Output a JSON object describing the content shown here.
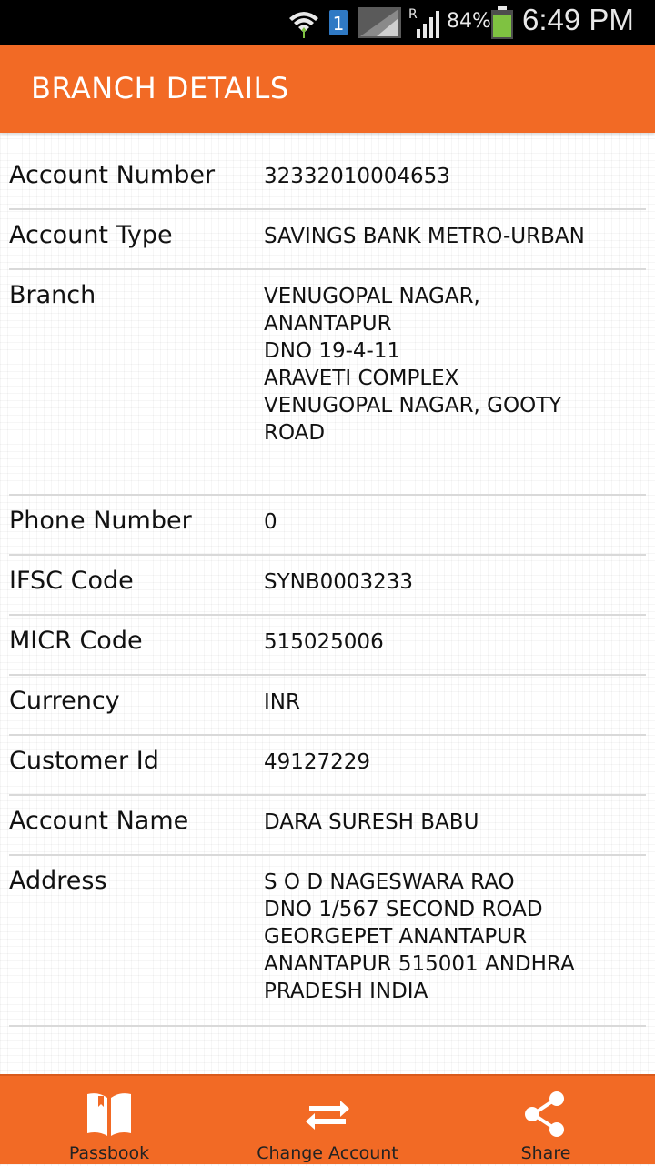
{
  "status_bar": {
    "sim_slot": "1",
    "roaming_indicator": "R",
    "battery_percent": "84%",
    "time": "6:49 PM",
    "icons": [
      "wifi-icon",
      "sim-icon",
      "signal-icon",
      "roaming-signal-icon",
      "battery-icon"
    ]
  },
  "header": {
    "title": "BRANCH DETAILS"
  },
  "details": [
    {
      "label": "Account Number",
      "value": "32332010004653"
    },
    {
      "label": "Account Type",
      "value": "SAVINGS BANK  METRO-URBAN"
    },
    {
      "label": "Branch",
      "value": "VENUGOPAL NAGAR,\nANANTAPUR\nDNO 19-4-11\nARAVETI COMPLEX\nVENUGOPAL NAGAR, GOOTY\nROAD"
    },
    {
      "label": "Phone Number",
      "value": "0"
    },
    {
      "label": "IFSC Code",
      "value": "SYNB0003233"
    },
    {
      "label": "MICR Code",
      "value": "515025006"
    },
    {
      "label": "Currency",
      "value": "INR"
    },
    {
      "label": "Customer Id",
      "value": "49127229"
    },
    {
      "label": "Account Name",
      "value": "DARA SURESH BABU"
    },
    {
      "label": "Address",
      "value": "S O D NAGESWARA RAO\nDNO 1/567 SECOND ROAD\nGEORGEPET  ANANTAPUR\nANANTAPUR 515001 ANDHRA\nPRADESH INDIA"
    }
  ],
  "bottom_nav": {
    "passbook": {
      "label": "Passbook",
      "icon": "book-icon"
    },
    "change_account": {
      "label": "Change Account",
      "icon": "swap-arrows-icon"
    },
    "share": {
      "label": "Share",
      "icon": "share-icon"
    }
  },
  "colors": {
    "accent": "#f26a25",
    "text": "#111111",
    "divider": "#d9d9d9",
    "status_bar": "#000000"
  }
}
